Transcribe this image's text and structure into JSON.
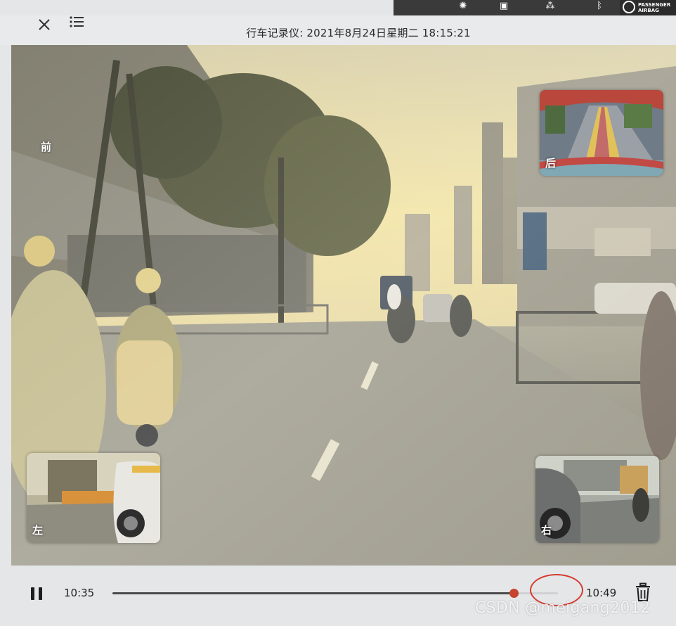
{
  "header": {
    "title": "行车记录仪: 2021年8月24日星期二  18:15:21"
  },
  "status_bar": {
    "airbag_line1": "PASSENGER",
    "airbag_line2": "AIRBAG"
  },
  "cameras": {
    "front_label": "前",
    "rear_label": "后",
    "left_label": "左",
    "right_label": "右"
  },
  "playback": {
    "current_time": "10:35",
    "end_time": "10:49",
    "progress": 0.9
  },
  "watermark": "CSDN @meigang2012",
  "colors": {
    "thumb": "#c7432f",
    "highlight_ring": "#d63a2e"
  }
}
